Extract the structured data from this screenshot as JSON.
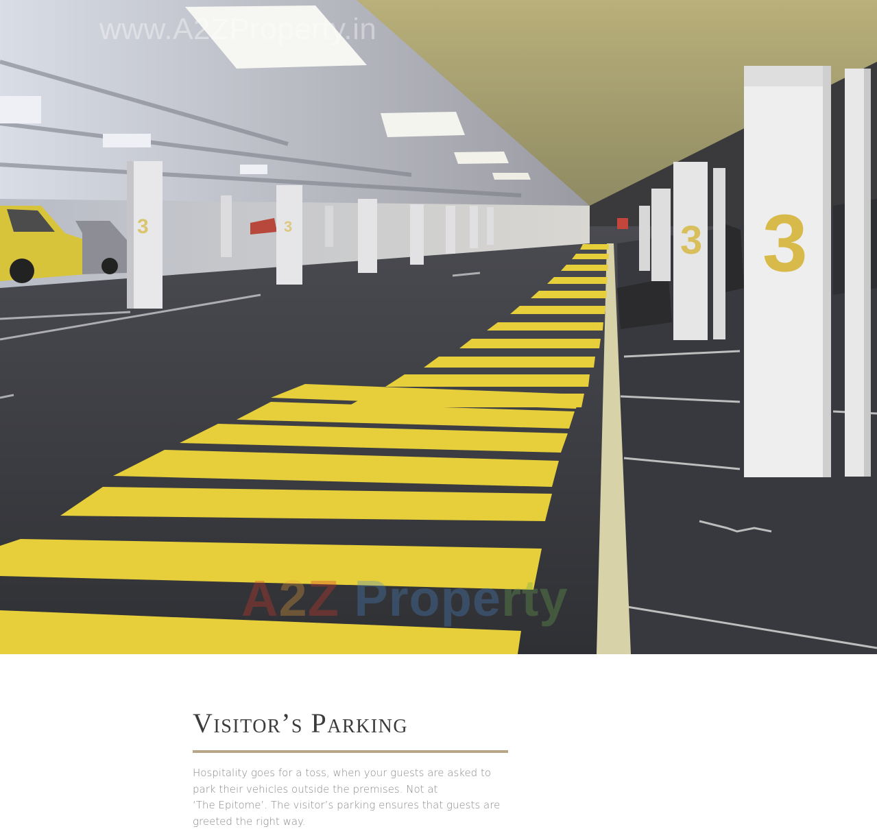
{
  "photo": {
    "watermark_url": "www.A2ZProperty.in",
    "watermark_logo": {
      "a": "A",
      "two": "2",
      "z": "Z",
      "p": " Prope",
      "rty": "rty"
    },
    "pillar_number": "3"
  },
  "section": {
    "title": "Visitor’s Parking",
    "lines": [
      "Hospitality goes for a toss, when your guests are asked to",
      "park their vehicles outside the premises. Not at",
      "‘The Epitome’. The visitor’s parking ensures that guests are",
      "greeted the right way."
    ]
  },
  "colors": {
    "accent_rule": "#b7a687",
    "stripe_yellow": "#e6cf3a"
  }
}
